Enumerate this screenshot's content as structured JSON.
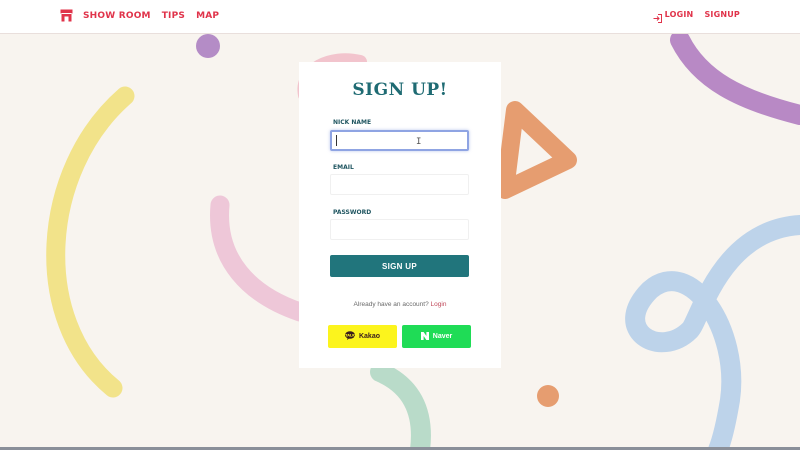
{
  "header": {
    "nav_left": [
      "SHOW ROOM",
      "TIPS",
      "MAP"
    ],
    "login_label": "LOGIN",
    "signup_label": "SIGNUP",
    "brand_color": "#e0334a"
  },
  "icons": {
    "store": "store-icon",
    "login": "login-icon",
    "kakao": "kakao-chat-icon",
    "naver": "naver-n-icon"
  },
  "form": {
    "title": "SIGN UP!",
    "nickname_label": "NICK NAME",
    "nickname_value": "",
    "email_label": "EMAIL",
    "email_value": "",
    "password_label": "PASSWORD",
    "password_value": "",
    "submit_label": "SIGN UP",
    "already_text": "Already have an account?",
    "login_link": "Login",
    "kakao_label": "Kakao",
    "naver_label": "Naver"
  },
  "colors": {
    "accent": "#21757c",
    "kakao": "#fcf41d",
    "naver": "#1fdc56",
    "background": "#f8f4ef"
  }
}
